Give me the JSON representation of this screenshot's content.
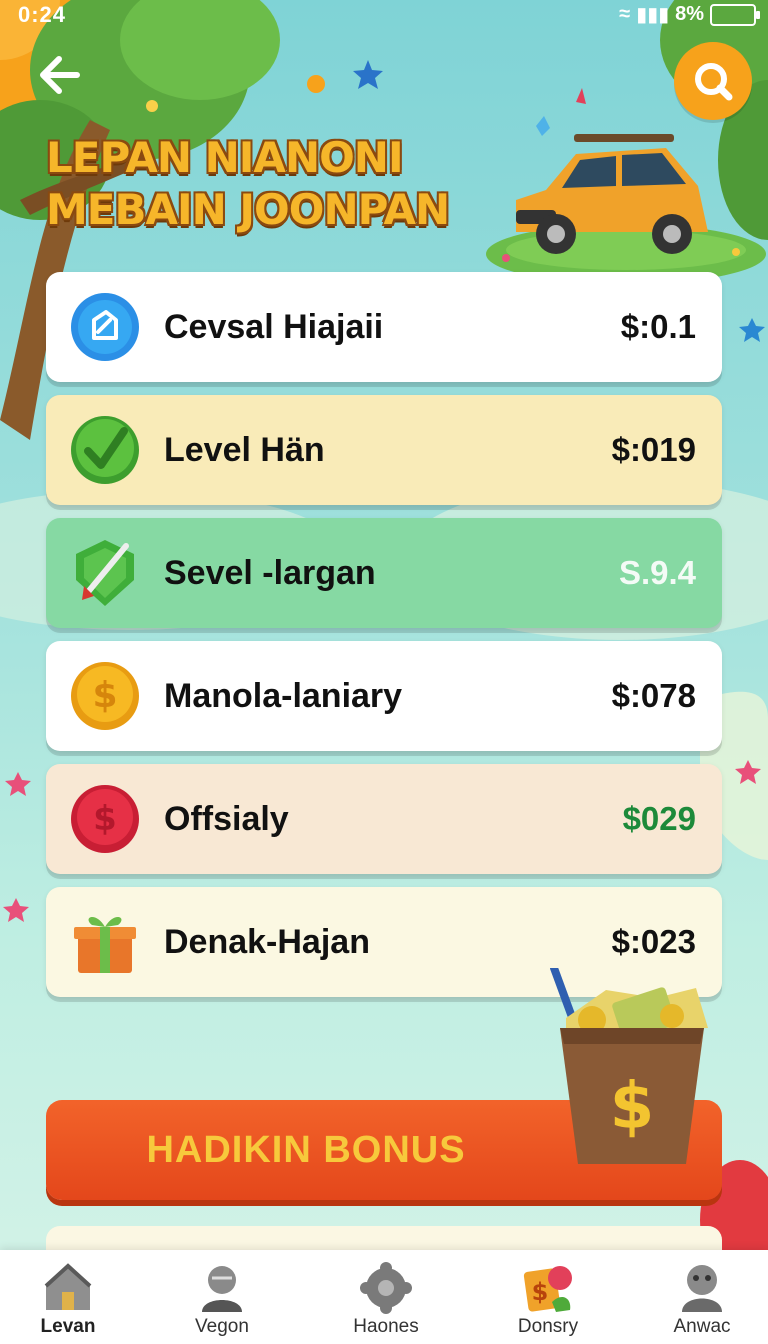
{
  "status_bar": {
    "time": "0:24",
    "battery": "8%"
  },
  "header": {
    "back_icon": "arrow-left-icon",
    "search_icon": "search-icon",
    "headline_line1": "LEPAN NIANONI",
    "headline_line2": "MEBAIN JOONPAN"
  },
  "rewards": [
    {
      "label": "Cevsal Hiajaii",
      "value": "$:0.1",
      "icon": "badge-icon",
      "bg": "#ffffff",
      "value_color": "#111111"
    },
    {
      "label": "Level Hän",
      "value": "$:019",
      "icon": "checkmark-icon",
      "bg": "#f9ebb8",
      "value_color": "#111111"
    },
    {
      "label": "Sevel -largan",
      "value": "S.9.4",
      "icon": "shield-sword-icon",
      "bg": "#86d9a3",
      "value_color": "#f4fbf6"
    },
    {
      "label": "Manola-laniary",
      "value": "$:078",
      "icon": "gold-coin-icon",
      "bg": "#ffffff",
      "value_color": "#111111"
    },
    {
      "label": "Offsialy",
      "value": "$029",
      "icon": "red-coin-icon",
      "bg": "#f8e8d4",
      "value_color": "#1d8a3a"
    },
    {
      "label": "Denak-Hajan",
      "value": "$:023",
      "icon": "gift-box-icon",
      "bg": "#fbf8e2",
      "value_color": "#111111"
    }
  ],
  "bonus_button": {
    "label": "HADIKIN BONUS"
  },
  "bottom_nav": [
    {
      "label": "Levan",
      "icon": "house-icon"
    },
    {
      "label": "Vegon",
      "icon": "person-icon"
    },
    {
      "label": "Haones",
      "icon": "gear-icon"
    },
    {
      "label": "Donsry",
      "icon": "cards-icon"
    },
    {
      "label": "Anwac",
      "icon": "profile-icon"
    }
  ],
  "colors": {
    "accent_orange": "#f7a21b",
    "bonus_red": "#e4471b",
    "headline_yellow": "#f6b62a"
  }
}
